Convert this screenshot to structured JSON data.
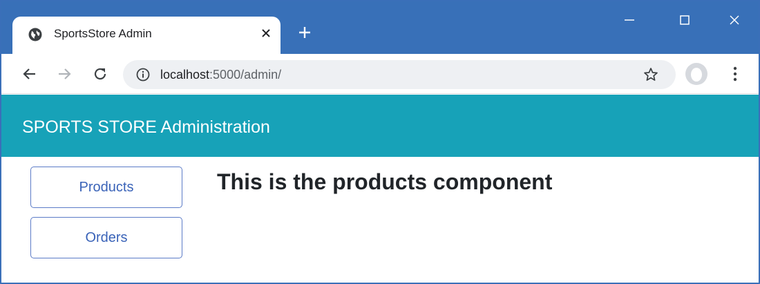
{
  "browser": {
    "tab": {
      "title": "SportsStore Admin",
      "favicon": "globe-icon",
      "close_icon": "close-icon"
    },
    "new_tab_icon": "plus-icon",
    "window_controls": [
      "minimize-icon",
      "maximize-icon",
      "close-icon"
    ],
    "toolbar": {
      "back_icon": "arrow-left-icon",
      "forward_icon": "arrow-right-icon",
      "reload_icon": "reload-icon",
      "address": {
        "host": "localhost",
        "path": ":5000/admin/",
        "security_icon": "info-icon"
      },
      "bookmark_icon": "star-icon",
      "profile_icon": "avatar",
      "menu_icon": "kebab-menu-icon"
    },
    "colors": {
      "frame": "#3870b8",
      "navbar": "#17a2b8",
      "button_border": "#5b7bc7",
      "button_text": "#3a63b8"
    }
  },
  "app": {
    "brand": "SPORTS STORE Administration",
    "nav": [
      {
        "label": "Products"
      },
      {
        "label": "Orders"
      }
    ],
    "heading": "This is the products component"
  }
}
